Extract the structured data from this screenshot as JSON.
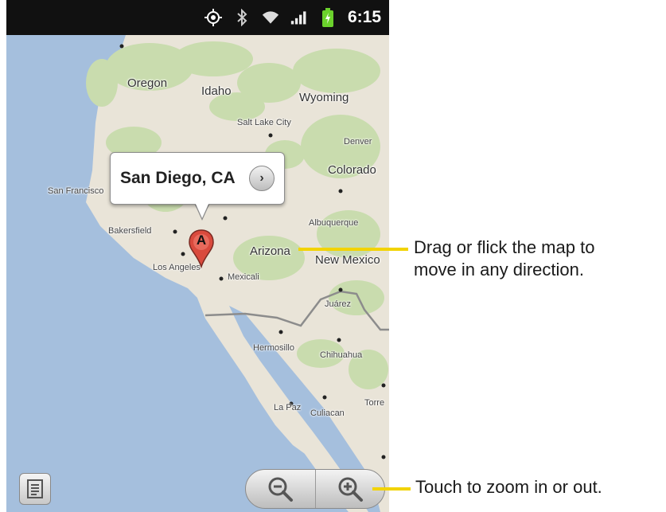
{
  "status_bar": {
    "time": "6:15",
    "icons": [
      "gps-icon",
      "bluetooth-icon",
      "wifi-icon",
      "signal-icon",
      "battery-charging-icon"
    ]
  },
  "map": {
    "labels": {
      "oregon": "Oregon",
      "idaho": "Idaho",
      "wyoming": "Wyoming",
      "salt_lake_city": "Salt Lake City",
      "denver": "Denver",
      "colorado": "Colorado",
      "san_francisco": "San Francisco",
      "bakersfield": "Bakersfield",
      "los_angeles": "Los Angeles",
      "albuquerque": "Albuquerque",
      "arizona": "Arizona",
      "new_mexico": "New Mexico",
      "mexicali": "Mexicali",
      "juarez": "Juárez",
      "hermosillo": "Hermosillo",
      "chihuahua": "Chihuahua",
      "la_paz": "La Paz",
      "culiacan": "Culiacan",
      "torreon": "Torre"
    },
    "callout": {
      "title": "San Diego, CA",
      "arrow": "›"
    },
    "marker": {
      "letter": "A"
    }
  },
  "controls": {
    "menu_icon": "list-icon",
    "zoom_out_icon": "zoom-out-icon",
    "zoom_in_icon": "zoom-in-icon"
  },
  "annotations": {
    "drag_line1": "Drag or flick the map to",
    "drag_line2": "move in any direction.",
    "zoom": "Touch to zoom in or out."
  },
  "colors": {
    "land": "#e9e4d8",
    "water": "#a5bfdd",
    "forest": "#c9dcae",
    "callout_line": "#f2d300",
    "marker": "#d94a3d"
  }
}
